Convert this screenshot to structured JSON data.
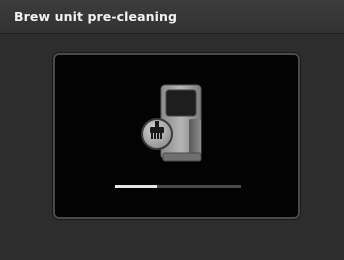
{
  "header": {
    "title": "Brew unit pre-cleaning"
  },
  "main": {
    "illustration_icon": "coffee-machine-brush-icon",
    "progress": {
      "fraction": 0.33
    }
  },
  "colors": {
    "background": "#2d2d2d",
    "panel": "#030303",
    "progress_fill": "#e6e6e6",
    "progress_track": "#4a4a4a"
  }
}
